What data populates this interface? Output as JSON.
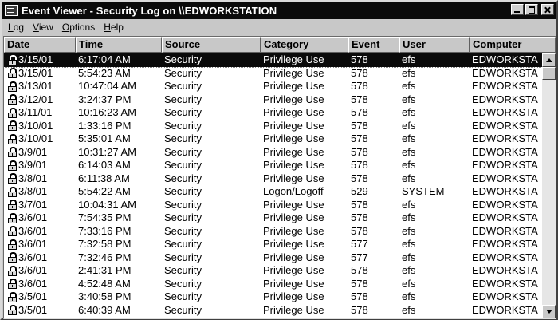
{
  "window": {
    "title": "Event Viewer - Security Log on \\\\EDWORKSTATION"
  },
  "menu": [
    {
      "label": "Log",
      "key": "L",
      "rest": "og"
    },
    {
      "label": "View",
      "key": "V",
      "rest": "iew"
    },
    {
      "label": "Options",
      "key": "O",
      "rest": "ptions"
    },
    {
      "label": "Help",
      "key": "H",
      "rest": "elp"
    }
  ],
  "columns": [
    "Date",
    "Time",
    "Source",
    "Category",
    "Event",
    "User",
    "Computer"
  ],
  "rows": [
    {
      "date": "3/15/01",
      "time": "6:17:04 AM",
      "source": "Security",
      "category": "Privilege Use",
      "event": "578",
      "user": "efs",
      "computer": "EDWORKSTA",
      "selected": true
    },
    {
      "date": "3/15/01",
      "time": "5:54:23 AM",
      "source": "Security",
      "category": "Privilege Use",
      "event": "578",
      "user": "efs",
      "computer": "EDWORKSTA"
    },
    {
      "date": "3/13/01",
      "time": "10:47:04 AM",
      "source": "Security",
      "category": "Privilege Use",
      "event": "578",
      "user": "efs",
      "computer": "EDWORKSTA"
    },
    {
      "date": "3/12/01",
      "time": "3:24:37 PM",
      "source": "Security",
      "category": "Privilege Use",
      "event": "578",
      "user": "efs",
      "computer": "EDWORKSTA"
    },
    {
      "date": "3/11/01",
      "time": "10:16:23 AM",
      "source": "Security",
      "category": "Privilege Use",
      "event": "578",
      "user": "efs",
      "computer": "EDWORKSTA"
    },
    {
      "date": "3/10/01",
      "time": "1:33:16 PM",
      "source": "Security",
      "category": "Privilege Use",
      "event": "578",
      "user": "efs",
      "computer": "EDWORKSTA"
    },
    {
      "date": "3/10/01",
      "time": "5:35:01 AM",
      "source": "Security",
      "category": "Privilege Use",
      "event": "578",
      "user": "efs",
      "computer": "EDWORKSTA"
    },
    {
      "date": "3/9/01",
      "time": "10:31:27 AM",
      "source": "Security",
      "category": "Privilege Use",
      "event": "578",
      "user": "efs",
      "computer": "EDWORKSTA"
    },
    {
      "date": "3/9/01",
      "time": "6:14:03 AM",
      "source": "Security",
      "category": "Privilege Use",
      "event": "578",
      "user": "efs",
      "computer": "EDWORKSTA"
    },
    {
      "date": "3/8/01",
      "time": "6:11:38 AM",
      "source": "Security",
      "category": "Privilege Use",
      "event": "578",
      "user": "efs",
      "computer": "EDWORKSTA"
    },
    {
      "date": "3/8/01",
      "time": "5:54:22 AM",
      "source": "Security",
      "category": "Logon/Logoff",
      "event": "529",
      "user": "SYSTEM",
      "computer": "EDWORKSTA"
    },
    {
      "date": "3/7/01",
      "time": "10:04:31 AM",
      "source": "Security",
      "category": "Privilege Use",
      "event": "578",
      "user": "efs",
      "computer": "EDWORKSTA"
    },
    {
      "date": "3/6/01",
      "time": "7:54:35 PM",
      "source": "Security",
      "category": "Privilege Use",
      "event": "578",
      "user": "efs",
      "computer": "EDWORKSTA"
    },
    {
      "date": "3/6/01",
      "time": "7:33:16 PM",
      "source": "Security",
      "category": "Privilege Use",
      "event": "578",
      "user": "efs",
      "computer": "EDWORKSTA"
    },
    {
      "date": "3/6/01",
      "time": "7:32:58 PM",
      "source": "Security",
      "category": "Privilege Use",
      "event": "577",
      "user": "efs",
      "computer": "EDWORKSTA"
    },
    {
      "date": "3/6/01",
      "time": "7:32:46 PM",
      "source": "Security",
      "category": "Privilege Use",
      "event": "577",
      "user": "efs",
      "computer": "EDWORKSTA"
    },
    {
      "date": "3/6/01",
      "time": "2:41:31 PM",
      "source": "Security",
      "category": "Privilege Use",
      "event": "578",
      "user": "efs",
      "computer": "EDWORKSTA"
    },
    {
      "date": "3/6/01",
      "time": "4:52:48 AM",
      "source": "Security",
      "category": "Privilege Use",
      "event": "578",
      "user": "efs",
      "computer": "EDWORKSTA"
    },
    {
      "date": "3/5/01",
      "time": "3:40:58 PM",
      "source": "Security",
      "category": "Privilege Use",
      "event": "578",
      "user": "efs",
      "computer": "EDWORKSTA"
    },
    {
      "date": "3/5/01",
      "time": "6:40:39 AM",
      "source": "Security",
      "category": "Privilege Use",
      "event": "578",
      "user": "efs",
      "computer": "EDWORKSTA"
    }
  ],
  "icons": {
    "app": "event-viewer-icon",
    "row": "lock-icon",
    "minimize": "minimize-icon",
    "maximize": "maximize-icon",
    "close": "close-icon"
  },
  "colors": {
    "title_bar": "#0a0a0a",
    "selection": "#0a0a0a",
    "chrome": "#c8c8c8"
  }
}
